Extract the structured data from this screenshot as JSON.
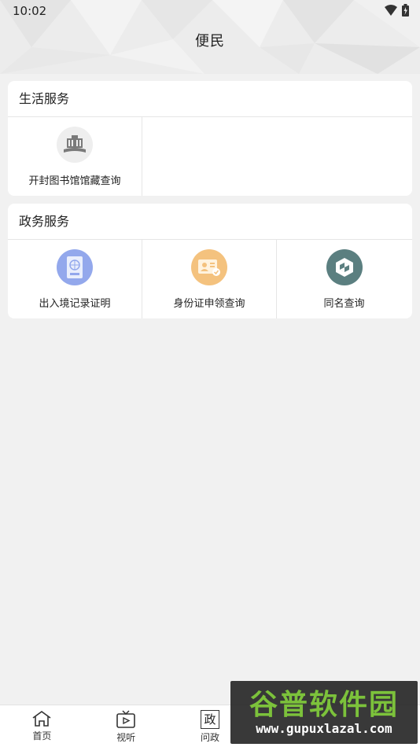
{
  "status_bar": {
    "time": "10:02"
  },
  "header": {
    "title": "便民"
  },
  "sections": [
    {
      "title": "生活服务",
      "items": [
        {
          "label": "开封图书馆馆藏查询",
          "icon": "library-icon",
          "color": "#eeeeee"
        }
      ]
    },
    {
      "title": "政务服务",
      "items": [
        {
          "label": "出入境记录证明",
          "icon": "passport-icon",
          "color": "#93a8ec"
        },
        {
          "label": "身份证申领查询",
          "icon": "id-card-icon",
          "color": "#f4c27e"
        },
        {
          "label": "同名查询",
          "icon": "shield-icon",
          "color": "#5b7f80"
        }
      ]
    }
  ],
  "tabbar": {
    "tabs": [
      {
        "label": "首页",
        "icon": "home-icon"
      },
      {
        "label": "视听",
        "icon": "video-icon"
      },
      {
        "label": "问政",
        "icon": "zheng-icon",
        "glyph": "政"
      }
    ]
  },
  "watermark": {
    "title": "谷普软件园",
    "url": "www.gupuxlazal.com"
  }
}
